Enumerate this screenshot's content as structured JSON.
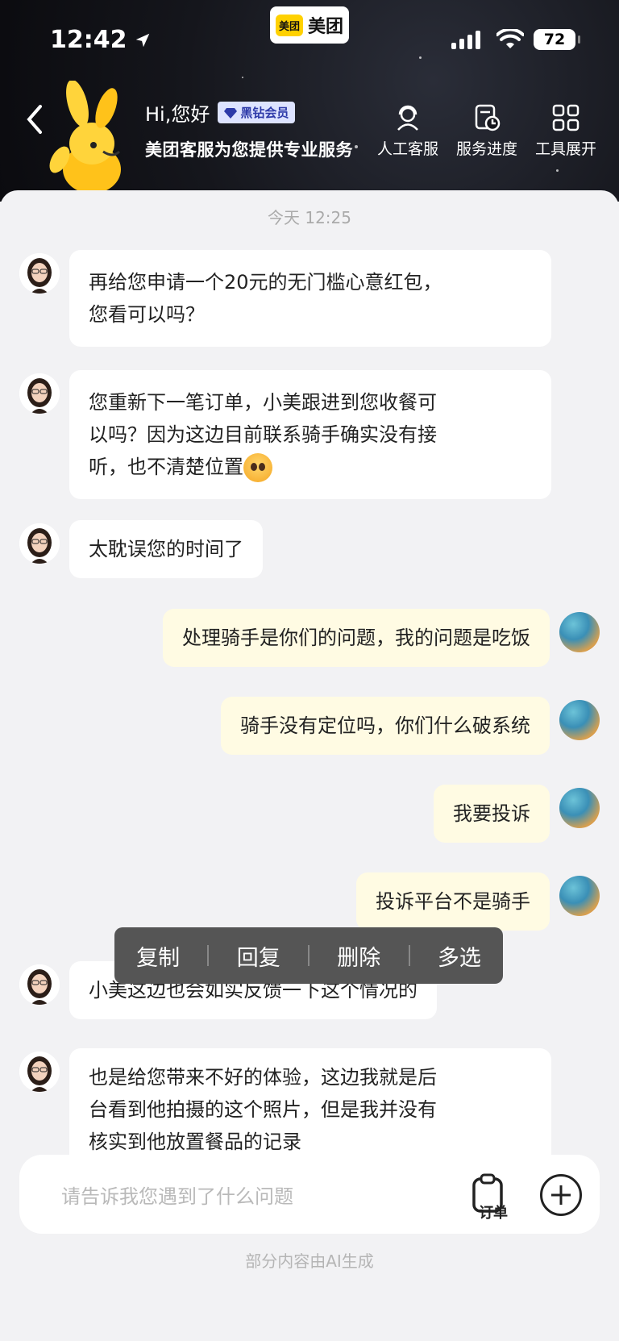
{
  "status_bar": {
    "time": "12:42",
    "battery": "72",
    "app_name": "美团",
    "app_logo": "美团"
  },
  "header": {
    "greeting": "Hi,您好",
    "badge": "黑钻会员",
    "subtitle": "美团客服为您提供专业服务",
    "tools": [
      {
        "label": "人工客服",
        "icon": "agent-headset-icon"
      },
      {
        "label": "服务进度",
        "icon": "progress-clock-icon"
      },
      {
        "label": "工具展开",
        "icon": "grid-icon"
      }
    ]
  },
  "chat": {
    "date": "今天 12:25",
    "messages": [
      {
        "side": "left",
        "text_lines": [
          "再给您申请一个20元的无门槛心意红包，",
          "您看可以吗？"
        ]
      },
      {
        "side": "left",
        "text_lines": [
          "您重新下一笔订单，小美跟进到您收餐可",
          "以吗？因为这边目前联系骑手确实没有接",
          "听，也不清楚位置"
        ],
        "emoji": "pleading-face"
      },
      {
        "side": "left",
        "text_lines": [
          "太耽误您的时间了"
        ]
      },
      {
        "side": "right",
        "text_lines": [
          "处理骑手是你们的问题，我的问题是吃饭"
        ]
      },
      {
        "side": "right",
        "text_lines": [
          "骑手没有定位吗，你们什么破系统"
        ]
      },
      {
        "side": "right",
        "text_lines": [
          "我要投诉"
        ]
      },
      {
        "side": "right",
        "text_lines": [
          "投诉平台不是骑手"
        ]
      },
      {
        "side": "left",
        "text_lines": [
          "小美这边也会如实反馈一下这个情况的"
        ]
      },
      {
        "side": "left",
        "text_lines": [
          " 也是给您带来不好的体验，这边我就是后",
          "台看到他拍摄的这个照片，但是我并没有",
          "核实到他放置餐品的记录"
        ]
      }
    ]
  },
  "context_menu": {
    "items": [
      "复制",
      "回复",
      "删除",
      "多选"
    ]
  },
  "input": {
    "placeholder": "请告诉我您遇到了什么问题",
    "order_label": "订单"
  },
  "footer_note": "部分内容由AI生成"
}
